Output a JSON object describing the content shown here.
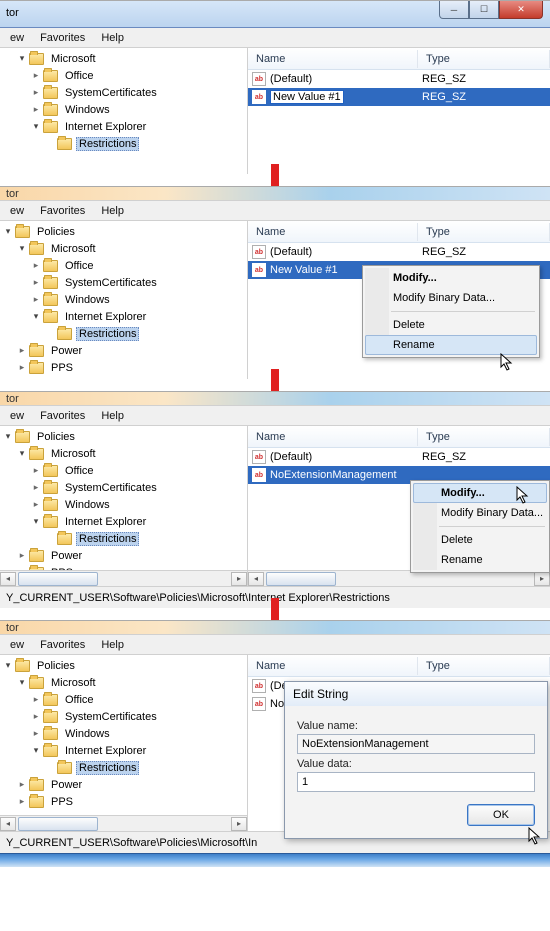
{
  "window": {
    "title_fragment": "tor"
  },
  "menu": {
    "ew": "ew",
    "favorites": "Favorites",
    "help": "Help"
  },
  "columns": {
    "name": "Name",
    "type": "Type"
  },
  "tree_common": {
    "policies": "Policies",
    "microsoft": "Microsoft",
    "office": "Office",
    "system_certificates": "SystemCertificates",
    "windows": "Windows",
    "internet_explorer": "Internet Explorer",
    "restrictions": "Restrictions",
    "power": "Power",
    "pps": "PPS"
  },
  "values": {
    "default": "(Default)",
    "new_value": "New Value #1",
    "noext": "NoExtensionManagement",
    "reg_sz": "REG_SZ"
  },
  "ctx1": {
    "modify": "Modify...",
    "modify_bin": "Modify Binary Data...",
    "delete": "Delete",
    "rename": "Rename"
  },
  "ctx2": {
    "modify": "Modify...",
    "modify_bin": "Modify Binary Data...",
    "delete": "Delete",
    "rename": "Rename"
  },
  "status": {
    "path1": "Y_CURRENT_USER\\Software\\Policies\\Microsoft\\Internet Explorer\\Restrictions",
    "path2": "Y_CURRENT_USER\\Software\\Policies\\Microsoft\\In"
  },
  "dialog": {
    "title": "Edit String",
    "value_name_label": "Value name:",
    "value_name": "NoExtensionManagement",
    "value_data_label": "Value data:",
    "value_data": "1",
    "ok": "OK"
  }
}
